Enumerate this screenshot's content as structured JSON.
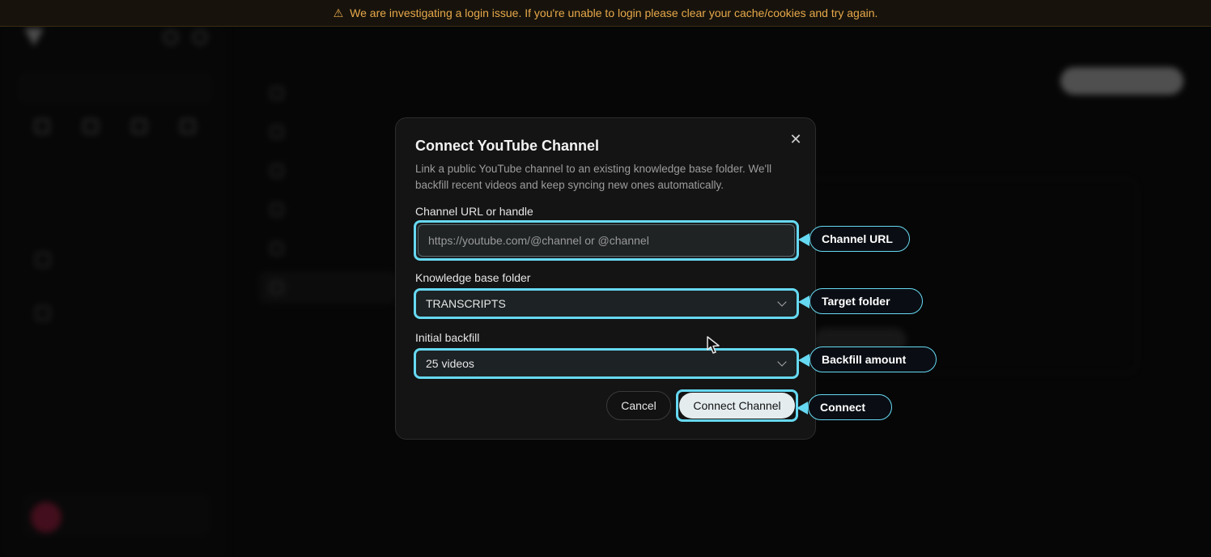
{
  "banner": {
    "icon": "warning-icon",
    "text": "We are investigating a login issue. If you're unable to login please clear your cache/cookies and try again."
  },
  "modal": {
    "title": "Connect YouTube Channel",
    "description": "Link a public YouTube channel to an existing knowledge base folder. We'll backfill recent videos and keep syncing new ones automatically.",
    "channel_label": "Channel URL or handle",
    "channel_placeholder": "https://youtube.com/@channel or @channel",
    "channel_value": "",
    "folder_label": "Knowledge base folder",
    "folder_value": "TRANSCRIPTS",
    "backfill_label": "Initial backfill",
    "backfill_value": "25 videos",
    "cancel_label": "Cancel",
    "connect_label": "Connect Channel"
  },
  "callouts": {
    "channel_url": "Channel URL",
    "target_folder": "Target folder",
    "backfill_amount": "Backfill amount",
    "connect": "Connect"
  },
  "colors": {
    "highlight": "#66d9f2",
    "banner_text": "#e7a84a",
    "modal_bg": "#141414"
  }
}
